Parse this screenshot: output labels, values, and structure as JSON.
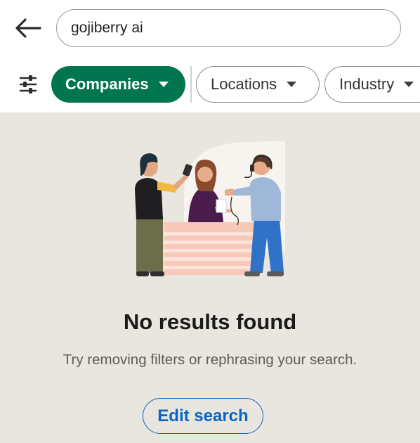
{
  "search": {
    "query": "gojiberry ai",
    "back_icon": "arrow-left-icon"
  },
  "filters": {
    "icon": "sliders-icon",
    "chips": [
      {
        "label": "Companies",
        "active": true
      },
      {
        "label": "Locations",
        "active": false
      },
      {
        "label": "Industry",
        "active": false
      }
    ]
  },
  "empty_state": {
    "illustration": "people-at-desk-illustration",
    "title": "No results found",
    "message": "Try removing filters or rephrasing your search.",
    "action_label": "Edit search"
  },
  "colors": {
    "active_chip": "#01754f",
    "link_blue": "#0a66c2",
    "background": "#e9e5df"
  }
}
